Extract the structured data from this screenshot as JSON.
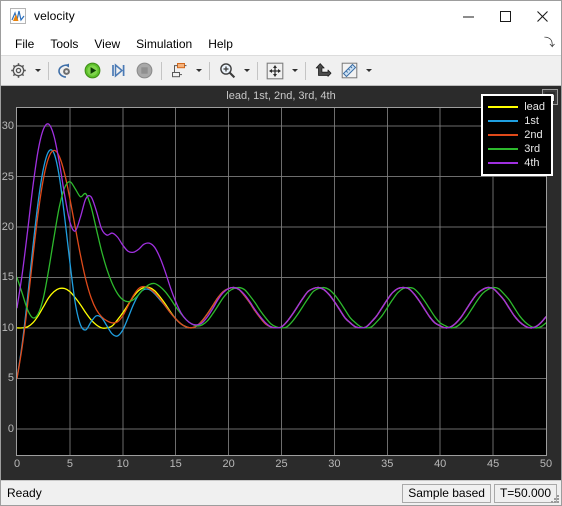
{
  "window": {
    "title": "velocity",
    "icon": "simulink-scope-icon",
    "controls": {
      "minimize": "minimize-icon",
      "maximize": "maximize-icon",
      "close": "close-icon"
    }
  },
  "menubar": {
    "items": [
      {
        "label": "File",
        "name": "menu-file"
      },
      {
        "label": "Tools",
        "name": "menu-tools"
      },
      {
        "label": "View",
        "name": "menu-view"
      },
      {
        "label": "Simulation",
        "name": "menu-simulation"
      },
      {
        "label": "Help",
        "name": "menu-help"
      }
    ],
    "overflow": "⤵"
  },
  "toolbar": {
    "buttons": [
      {
        "name": "configuration-properties-button",
        "icon": "gear-icon",
        "caret": true
      },
      {
        "name": "run-back-to-start-button",
        "icon": "rewind-icon",
        "caret": false
      },
      {
        "name": "run-button",
        "icon": "play-icon",
        "caret": false
      },
      {
        "name": "step-forward-button",
        "icon": "step-forward-icon",
        "caret": false
      },
      {
        "name": "stop-button",
        "icon": "stop-icon",
        "caret": false
      },
      {
        "name": "simulink-model-button",
        "icon": "block-diagram-icon",
        "caret": true
      },
      {
        "name": "zoom-button",
        "icon": "zoom-in-icon",
        "caret": true
      },
      {
        "name": "autoscale-button",
        "icon": "fit-to-view-icon",
        "caret": true
      },
      {
        "name": "cursor-measurements-button",
        "icon": "cursor-measurements-icon",
        "caret": false
      },
      {
        "name": "measurements-button",
        "icon": "ruler-icon",
        "caret": true
      }
    ]
  },
  "scope": {
    "plot_title": "lead, 1st, 2nd, 3rd, 4th",
    "dock_icon": "undock-icon",
    "background": "#000000",
    "panel_background": "#2b2b2b",
    "grid_color": "#808080",
    "axis_color": "#9e9e9e",
    "tick_label_color": "#b9b9b9"
  },
  "legend": {
    "entries": [
      {
        "label": "lead",
        "color": "#ffff00"
      },
      {
        "label": "1st",
        "color": "#1f9fe0"
      },
      {
        "label": "2nd",
        "color": "#e04a1a"
      },
      {
        "label": "3rd",
        "color": "#2db92d"
      },
      {
        "label": "4th",
        "color": "#a030e0"
      }
    ]
  },
  "statusbar": {
    "ready": "Ready",
    "sample_mode": "Sample based",
    "time": "T=50.000"
  },
  "chart_data": {
    "type": "line",
    "title": "lead, 1st, 2nd, 3rd, 4th",
    "xlabel": "",
    "ylabel": "",
    "xlim": [
      0,
      50
    ],
    "ylim": [
      -2.6,
      31.8
    ],
    "xticks": [
      0,
      5,
      10,
      15,
      20,
      25,
      30,
      35,
      40,
      45,
      50
    ],
    "yticks": [
      0,
      5,
      10,
      15,
      20,
      25,
      30
    ],
    "grid": true,
    "legend_position": "top-right",
    "x": [
      0,
      0.5,
      1,
      1.5,
      2,
      2.5,
      3,
      3.5,
      4,
      4.5,
      5,
      5.5,
      6,
      6.5,
      7,
      7.5,
      8,
      8.5,
      9,
      9.5,
      10,
      10.5,
      11,
      11.5,
      12,
      12.5,
      13,
      13.5,
      14,
      14.5,
      15,
      15.5,
      16,
      16.5,
      17,
      17.5,
      18,
      18.5,
      19,
      19.5,
      20,
      20.5,
      21,
      21.5,
      22,
      22.5,
      23,
      23.5,
      24,
      24.5,
      25,
      25.5,
      26,
      26.5,
      27,
      27.5,
      28,
      28.5,
      29,
      29.5,
      30,
      30.5,
      31,
      31.5,
      32,
      32.5,
      33,
      33.5,
      34,
      34.5,
      35,
      35.5,
      36,
      36.5,
      37,
      37.5,
      38,
      38.5,
      39,
      39.5,
      40,
      40.5,
      41,
      41.5,
      42,
      42.5,
      43,
      43.5,
      44,
      44.5,
      45,
      45.5,
      46,
      46.5,
      47,
      47.5,
      48,
      48.5,
      49,
      49.5,
      50
    ],
    "series": [
      {
        "name": "lead",
        "color": "#ffff00",
        "values": [
          10.0,
          10.0,
          10.1,
          10.5,
          11.2,
          12.1,
          13.0,
          13.6,
          13.9,
          13.9,
          13.6,
          13.0,
          12.3,
          11.5,
          10.8,
          10.3,
          10.0,
          10.0,
          10.2,
          10.8,
          11.5,
          12.3,
          13.1,
          13.7,
          14.0,
          14.0,
          13.7,
          13.1,
          12.4,
          11.6,
          10.9,
          10.4,
          10.1,
          10.0,
          10.2,
          10.7,
          11.4,
          12.2,
          13.0,
          13.6,
          13.9,
          14.0,
          13.8,
          13.2,
          12.5,
          11.7,
          11.0,
          10.4,
          10.1,
          10.0,
          10.1,
          10.6,
          11.3,
          12.1,
          12.9,
          13.6,
          13.9,
          14.0,
          13.8,
          13.3,
          12.6,
          11.8,
          11.0,
          10.5,
          10.1,
          10.0,
          10.1,
          10.6,
          11.2,
          12.0,
          12.8,
          13.5,
          13.9,
          14.0,
          13.9,
          13.4,
          12.7,
          11.9,
          11.1,
          10.5,
          10.2,
          10.0,
          10.1,
          10.5,
          11.1,
          11.9,
          12.7,
          13.4,
          13.8,
          14.0,
          13.9,
          13.4,
          12.8,
          12.0,
          11.2,
          10.6,
          10.2,
          10.0,
          10.1,
          10.5,
          11.1
        ]
      },
      {
        "name": "1st",
        "color": "#1f9fe0",
        "values": [
          5.0,
          8.5,
          13.0,
          18.0,
          22.5,
          25.8,
          27.5,
          27.3,
          25.0,
          21.0,
          16.5,
          12.5,
          10.3,
          9.8,
          10.6,
          11.2,
          11.0,
          10.2,
          9.4,
          9.2,
          9.8,
          11.0,
          12.3,
          13.3,
          13.8,
          13.8,
          13.4,
          12.8,
          12.2,
          11.5,
          10.9,
          10.4,
          10.1,
          10.0,
          10.2,
          10.7,
          11.4,
          12.2,
          13.0,
          13.6,
          13.9,
          14.0,
          13.8,
          13.2,
          12.5,
          11.7,
          11.0,
          10.4,
          10.1,
          10.0,
          10.1,
          10.6,
          11.3,
          12.1,
          12.9,
          13.6,
          13.9,
          14.0,
          13.8,
          13.3,
          12.6,
          11.8,
          11.0,
          10.5,
          10.1,
          10.0,
          10.1,
          10.6,
          11.2,
          12.0,
          12.8,
          13.5,
          13.9,
          14.0,
          13.9,
          13.4,
          12.7,
          11.9,
          11.1,
          10.5,
          10.2,
          10.0,
          10.1,
          10.5,
          11.1,
          11.9,
          12.7,
          13.4,
          13.8,
          14.0,
          13.9,
          13.4,
          12.8,
          12.0,
          11.2,
          10.6,
          10.2,
          10.0,
          10.1,
          10.5,
          11.1
        ]
      },
      {
        "name": "2nd",
        "color": "#e04a1a",
        "values": [
          5.0,
          8.2,
          12.3,
          17.0,
          21.4,
          24.8,
          26.9,
          27.6,
          27.0,
          25.3,
          22.8,
          20.0,
          17.2,
          14.8,
          13.0,
          11.8,
          11.1,
          10.7,
          10.5,
          10.6,
          11.2,
          12.2,
          13.2,
          13.9,
          14.1,
          13.9,
          13.5,
          12.9,
          12.2,
          11.5,
          10.9,
          10.4,
          10.1,
          10.0,
          10.2,
          10.7,
          11.4,
          12.2,
          13.0,
          13.6,
          13.9,
          14.0,
          13.8,
          13.2,
          12.5,
          11.7,
          11.0,
          10.4,
          10.1,
          10.0,
          10.1,
          10.6,
          11.3,
          12.1,
          12.9,
          13.6,
          13.9,
          14.0,
          13.8,
          13.3,
          12.6,
          11.8,
          11.0,
          10.5,
          10.1,
          10.0,
          10.1,
          10.6,
          11.2,
          12.0,
          12.8,
          13.5,
          13.9,
          14.0,
          13.9,
          13.4,
          12.7,
          11.9,
          11.1,
          10.5,
          10.2,
          10.0,
          10.1,
          10.5,
          11.1,
          11.9,
          12.7,
          13.4,
          13.8,
          14.0,
          13.9,
          13.4,
          12.8,
          12.0,
          11.2,
          10.6,
          10.2,
          10.0,
          10.1,
          10.5,
          11.1
        ]
      },
      {
        "name": "3rd",
        "color": "#2db92d",
        "values": [
          15.0,
          13.4,
          11.8,
          11.0,
          11.4,
          13.0,
          15.8,
          19.0,
          22.0,
          23.9,
          24.5,
          23.8,
          23.0,
          23.3,
          22.0,
          19.8,
          17.6,
          15.8,
          14.4,
          13.4,
          12.8,
          12.6,
          12.8,
          13.3,
          13.9,
          14.3,
          14.4,
          14.1,
          13.6,
          12.9,
          12.1,
          11.4,
          10.8,
          10.4,
          10.2,
          10.3,
          10.7,
          11.4,
          12.2,
          13.0,
          13.6,
          13.9,
          14.0,
          13.8,
          13.2,
          12.5,
          11.7,
          11.0,
          10.4,
          10.1,
          10.0,
          10.1,
          10.6,
          11.3,
          12.1,
          12.9,
          13.6,
          13.9,
          14.0,
          13.8,
          13.3,
          12.6,
          11.8,
          11.0,
          10.5,
          10.1,
          10.0,
          10.1,
          10.6,
          11.2,
          12.0,
          12.8,
          13.5,
          13.9,
          14.0,
          13.9,
          13.4,
          12.7,
          11.9,
          11.1,
          10.5,
          10.2,
          10.0,
          10.1,
          10.5,
          11.1,
          11.9,
          12.7,
          13.4,
          13.8,
          14.0,
          13.9,
          13.4,
          12.8,
          12.0,
          11.2,
          10.6,
          10.2,
          10.0,
          10.1,
          10.5
        ]
      },
      {
        "name": "4th",
        "color": "#a030e0",
        "values": [
          12.0,
          15.4,
          19.6,
          24.0,
          27.6,
          29.7,
          30.2,
          29.0,
          26.4,
          23.2,
          20.5,
          19.6,
          21.0,
          22.8,
          23.0,
          21.6,
          19.8,
          19.2,
          19.4,
          19.0,
          18.2,
          17.6,
          17.5,
          17.8,
          18.3,
          18.4,
          18.0,
          17.0,
          15.6,
          14.0,
          12.6,
          11.5,
          10.8,
          10.4,
          10.3,
          10.5,
          11.1,
          11.9,
          12.8,
          13.5,
          13.9,
          14.0,
          13.8,
          13.3,
          12.6,
          11.8,
          11.1,
          10.5,
          10.1,
          10.0,
          10.1,
          10.6,
          11.3,
          12.1,
          12.9,
          13.6,
          13.9,
          14.0,
          13.8,
          13.3,
          12.6,
          11.8,
          11.0,
          10.5,
          10.1,
          10.0,
          10.1,
          10.6,
          11.2,
          12.0,
          12.8,
          13.5,
          13.9,
          14.0,
          13.9,
          13.4,
          12.7,
          11.9,
          11.1,
          10.5,
          10.2,
          10.0,
          10.1,
          10.5,
          11.1,
          11.9,
          12.7,
          13.4,
          13.8,
          14.0,
          13.9,
          13.4,
          12.8,
          12.0,
          11.2,
          10.6,
          10.2,
          10.0,
          10.1,
          10.5,
          11.1
        ]
      }
    ]
  }
}
